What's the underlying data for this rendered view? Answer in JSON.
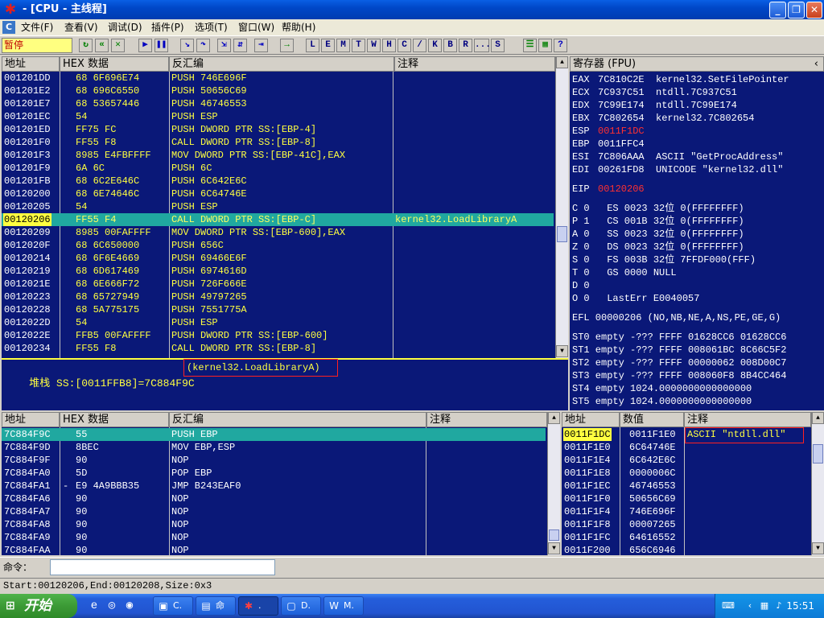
{
  "window": {
    "title": "- [CPU - 主线程]"
  },
  "menu": {
    "items": [
      "文件(F)",
      "查看(V)",
      "调试(D)",
      "插件(P)",
      "选项(T)",
      "窗口(W)",
      "帮助(H)"
    ]
  },
  "toolbar": {
    "status": "暂停",
    "letter_buttons": [
      "L",
      "E",
      "M",
      "T",
      "W",
      "H",
      "C",
      "/",
      "K",
      "B",
      "R",
      "...",
      "S"
    ]
  },
  "disasm": {
    "headers": [
      "地址",
      "HEX 数据",
      "反汇编",
      "注释"
    ],
    "rows": [
      {
        "addr": "001201DD",
        "hex": "68 6F696E74",
        "asm": "PUSH 746E696F",
        "comment": ""
      },
      {
        "addr": "001201E2",
        "hex": "68 696C6550",
        "asm": "PUSH 50656C69",
        "comment": ""
      },
      {
        "addr": "001201E7",
        "hex": "68 53657446",
        "asm": "PUSH 46746553",
        "comment": ""
      },
      {
        "addr": "001201EC",
        "hex": "54",
        "asm": "PUSH ESP",
        "comment": ""
      },
      {
        "addr": "001201ED",
        "hex": "FF75 FC",
        "asm": "PUSH DWORD PTR SS:[EBP-4]",
        "comment": ""
      },
      {
        "addr": "001201F0",
        "hex": "FF55 F8",
        "asm": "CALL DWORD PTR SS:[EBP-8]",
        "comment": ""
      },
      {
        "addr": "001201F3",
        "hex": "8985 E4FBFFFF",
        "asm": "MOV DWORD PTR SS:[EBP-41C],EAX",
        "comment": ""
      },
      {
        "addr": "001201F9",
        "hex": "6A 6C",
        "asm": "PUSH 6C",
        "comment": ""
      },
      {
        "addr": "001201FB",
        "hex": "68 6C2E646C",
        "asm": "PUSH 6C642E6C",
        "comment": ""
      },
      {
        "addr": "00120200",
        "hex": "68 6E74646C",
        "asm": "PUSH 6C64746E",
        "comment": ""
      },
      {
        "addr": "00120205",
        "hex": "54",
        "asm": "PUSH ESP",
        "comment": ""
      },
      {
        "addr": "00120206",
        "hex": "FF55 F4",
        "asm": "CALL DWORD PTR SS:[EBP-C]",
        "comment": "kernel32.LoadLibraryA"
      },
      {
        "addr": "00120209",
        "hex": "8985 00FAFFFF",
        "asm": "MOV DWORD PTR SS:[EBP-600],EAX",
        "comment": ""
      },
      {
        "addr": "0012020F",
        "hex": "68 6C650000",
        "asm": "PUSH 656C",
        "comment": ""
      },
      {
        "addr": "00120214",
        "hex": "68 6F6E4669",
        "asm": "PUSH 69466E6F",
        "comment": ""
      },
      {
        "addr": "00120219",
        "hex": "68 6D617469",
        "asm": "PUSH 6974616D",
        "comment": ""
      },
      {
        "addr": "0012021E",
        "hex": "68 6E666F72",
        "asm": "PUSH 726F666E",
        "comment": ""
      },
      {
        "addr": "00120223",
        "hex": "68 65727949",
        "asm": "PUSH 49797265",
        "comment": ""
      },
      {
        "addr": "00120228",
        "hex": "68 5A775175",
        "asm": "PUSH 7551775A",
        "comment": ""
      },
      {
        "addr": "0012022D",
        "hex": "54",
        "asm": "PUSH ESP",
        "comment": ""
      },
      {
        "addr": "0012022E",
        "hex": "FFB5 00FAFFFF",
        "asm": "PUSH DWORD PTR SS:[EBP-600]",
        "comment": ""
      },
      {
        "addr": "00120234",
        "hex": "FF55 F8",
        "asm": "CALL DWORD PTR SS:[EBP-8]",
        "comment": ""
      }
    ],
    "info_label": "堆栈",
    "info_text": "SS:[0011FFB8]=7C884F9C",
    "info_boxed": "(kernel32.LoadLibraryA)"
  },
  "registers": {
    "header": "寄存器 (FPU)",
    "lines": [
      {
        "name": "EAX",
        "val": "7C810C2E",
        "desc": "kernel32.SetFilePointer",
        "changed": false
      },
      {
        "name": "ECX",
        "val": "7C937C51",
        "desc": "ntdll.7C937C51",
        "changed": false
      },
      {
        "name": "EDX",
        "val": "7C99E174",
        "desc": "ntdll.7C99E174",
        "changed": false
      },
      {
        "name": "EBX",
        "val": "7C802654",
        "desc": "kernel32.7C802654",
        "changed": false
      },
      {
        "name": "ESP",
        "val": "0011F1DC",
        "desc": "",
        "changed": true
      },
      {
        "name": "EBP",
        "val": "0011FFC4",
        "desc": "",
        "changed": false
      },
      {
        "name": "ESI",
        "val": "7C806AAA",
        "desc": "ASCII \"GetProcAddress\"",
        "changed": false
      },
      {
        "name": "EDI",
        "val": "00261FD8",
        "desc": "UNICODE \"kernel32.dll\"",
        "changed": false
      }
    ],
    "eip": {
      "name": "EIP",
      "val": "00120206"
    },
    "flags": [
      "C 0   ES 0023 32位 0(FFFFFFFF)",
      "P 1   CS 001B 32位 0(FFFFFFFF)",
      "A 0   SS 0023 32位 0(FFFFFFFF)",
      "Z 0   DS 0023 32位 0(FFFFFFFF)",
      "S 0   FS 003B 32位 7FFDF000(FFF)",
      "T 0   GS 0000 NULL",
      "D 0",
      "O 0   LastErr E0040057"
    ],
    "efl": "EFL 00000206 (NO,NB,NE,A,NS,PE,GE,G)",
    "fpu": [
      "ST0 empty -??? FFFF 01628CC6 01628CC6",
      "ST1 empty -??? FFFF 008061BC 8C66C5F2",
      "ST2 empty -??? FFFF 00000062 008D00C7",
      "ST3 empty -??? FFFF 008060F8 8B4CC464",
      "ST4 empty 1024.0000000000000000",
      "ST5 empty 1024.0000000000000000"
    ]
  },
  "dump": {
    "headers": [
      "地址",
      "HEX 数据",
      "反汇编",
      "注释"
    ],
    "rows": [
      {
        "addr": "7C884F9C",
        "mark": "",
        "hex": "55",
        "asm": "PUSH EBP"
      },
      {
        "addr": "7C884F9D",
        "mark": "",
        "hex": "8BEC",
        "asm": "MOV EBP,ESP"
      },
      {
        "addr": "7C884F9F",
        "mark": "",
        "hex": "90",
        "asm": "NOP"
      },
      {
        "addr": "7C884FA0",
        "mark": "",
        "hex": "5D",
        "asm": "POP EBP"
      },
      {
        "addr": "7C884FA1",
        "mark": "-",
        "hex": "E9 4A9BBB35",
        "asm": "JMP B243EAF0"
      },
      {
        "addr": "7C884FA6",
        "mark": "",
        "hex": "90",
        "asm": "NOP"
      },
      {
        "addr": "7C884FA7",
        "mark": "",
        "hex": "90",
        "asm": "NOP"
      },
      {
        "addr": "7C884FA8",
        "mark": "",
        "hex": "90",
        "asm": "NOP"
      },
      {
        "addr": "7C884FA9",
        "mark": "",
        "hex": "90",
        "asm": "NOP"
      },
      {
        "addr": "7C884FAA",
        "mark": "",
        "hex": "90",
        "asm": "NOP"
      }
    ]
  },
  "stack": {
    "headers": [
      "地址",
      "数值",
      "注释"
    ],
    "rows": [
      {
        "addr": "0011F1DC",
        "val": "0011F1E0",
        "comment": "ASCII \"ntdll.dll\""
      },
      {
        "addr": "0011F1E0",
        "val": "6C64746E",
        "comment": ""
      },
      {
        "addr": "0011F1E4",
        "val": "6C642E6C",
        "comment": ""
      },
      {
        "addr": "0011F1E8",
        "val": "0000006C",
        "comment": ""
      },
      {
        "addr": "0011F1EC",
        "val": "46746553",
        "comment": ""
      },
      {
        "addr": "0011F1F0",
        "val": "50656C69",
        "comment": ""
      },
      {
        "addr": "0011F1F4",
        "val": "746E696F",
        "comment": ""
      },
      {
        "addr": "0011F1F8",
        "val": "00007265",
        "comment": ""
      },
      {
        "addr": "0011F1FC",
        "val": "64616552",
        "comment": ""
      },
      {
        "addr": "0011F200",
        "val": "656C6946",
        "comment": ""
      }
    ]
  },
  "command": {
    "label": "命令：",
    "value": ""
  },
  "status": {
    "text": "Start:00120206,End:00120208,Size:0x3"
  },
  "taskbar": {
    "start": "开始",
    "tasks": [
      {
        "label": "C.",
        "icon": "folder-icon"
      },
      {
        "label": "命",
        "icon": "console-icon"
      },
      {
        "label": ".",
        "icon": "debugger-icon"
      },
      {
        "label": "D.",
        "icon": "window-icon"
      },
      {
        "label": "M.",
        "icon": "word-icon"
      }
    ],
    "clock": "15:51"
  }
}
